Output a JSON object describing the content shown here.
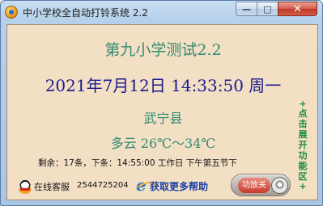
{
  "window": {
    "title": "中小学校全自动打铃系统  2.2",
    "controls": {
      "minimize": "—",
      "maximize": "□",
      "close": "✕"
    }
  },
  "display": {
    "school_name": "第九小学测试2.2",
    "datetime": "2021年7月12日  14:33:50 周一",
    "county": "武宁县",
    "weather": "多云   26℃～34℃",
    "status": "剩余：17条，下条：14:55:00 工作日  下午第五节下"
  },
  "side_panel": {
    "top_marker": "+",
    "label_chars": [
      "点",
      "击",
      "展",
      "开",
      "功",
      "能",
      "区"
    ],
    "bottom_marker": "+"
  },
  "footer": {
    "service_label": "在线客服",
    "service_number": "2544725204",
    "help_link": "获取更多帮助",
    "toggle_label": "功放关"
  },
  "colors": {
    "panel_bg": "#f3dfc4",
    "text_green": "#2e8b72",
    "text_blue": "#1a1a8c",
    "side_green": "#1a8a3a",
    "close_red": "#c0392b"
  },
  "icons": [
    "app-icon",
    "qq-icon",
    "ie-icon",
    "toggle-knob"
  ]
}
